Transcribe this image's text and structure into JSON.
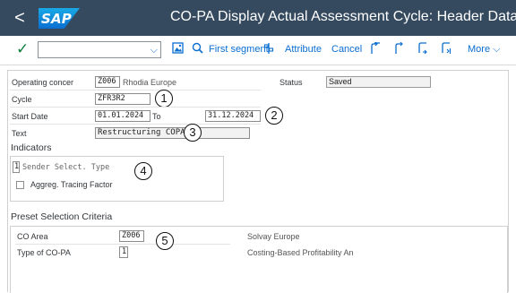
{
  "header": {
    "title": "CO-PA Display Actual Assessment Cycle: Header Data",
    "logo_text": "SAP",
    "back_symbol": "<"
  },
  "toolbar": {
    "confirm_symbol": "✓",
    "command_value": "",
    "command_chevron": "⌵",
    "first_segment": "First segment",
    "attribute": "Attribute",
    "cancel": "Cancel",
    "more": "More ⌵"
  },
  "form": {
    "operating_concern_label": "Operating concer",
    "operating_concern_value": "Z006",
    "operating_concern_desc": "Rhodia Europe",
    "status_label": "Status",
    "status_value": "Saved",
    "cycle_label": "Cycle",
    "cycle_value": "ZFR3R2",
    "start_date_label": "Start Date",
    "start_date_value": "01.01.2024",
    "to_label": "To",
    "end_date_value": "31.12.2024",
    "text_label": "Text",
    "text_value": "Restructuring COPA"
  },
  "indicators": {
    "title": "Indicators",
    "sender_select_value": "1",
    "sender_select_label": "Sender Select. Type",
    "aggreg_label": "Aggreg. Tracing Factor"
  },
  "preset": {
    "title": "Preset Selection Criteria",
    "co_area_label": "CO Area",
    "co_area_value": "Z006",
    "co_area_desc": "Solvay Europe",
    "type_label": "Type of CO-PA",
    "type_value": "1",
    "type_desc": "Costing-Based Profitability An"
  },
  "callouts": [
    "1",
    "2",
    "3",
    "4",
    "5"
  ],
  "colors": {
    "shell": "#354a5f",
    "accent": "#0a6ed1",
    "confirm": "#107e3e"
  }
}
